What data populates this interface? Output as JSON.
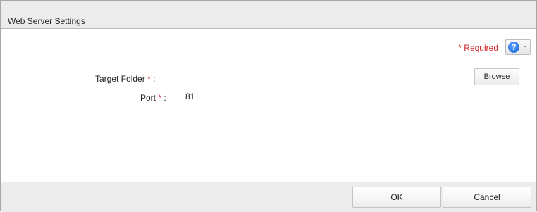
{
  "dialog": {
    "title": "Web Server Settings"
  },
  "toolbar": {
    "required_label": "Required",
    "required_mark": "*",
    "help_icon": "question-icon",
    "help_glyph": "?",
    "help_caret": "-"
  },
  "form": {
    "target_folder": {
      "label": "Target Folder",
      "required_mark": "*",
      "colon": ":"
    },
    "port": {
      "label": "Port",
      "required_mark": "*",
      "colon": ":",
      "value": "81"
    },
    "browse_label": "Browse"
  },
  "footer": {
    "ok_label": "OK",
    "cancel_label": "Cancel"
  },
  "colors": {
    "required": "#d21f1f",
    "help_icon": "#1763d6",
    "chrome": "#ececec"
  }
}
